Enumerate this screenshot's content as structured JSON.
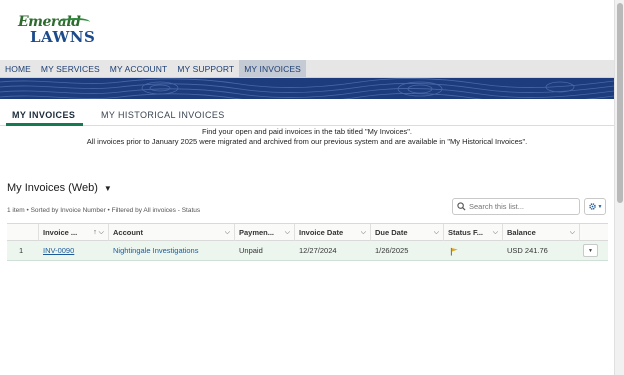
{
  "brand": {
    "script": "Emerald",
    "word": "LAWNS",
    "colors": {
      "green": "#2e6b2f",
      "blue": "#1d4a8a"
    }
  },
  "nav": {
    "items": [
      {
        "label": "HOME"
      },
      {
        "label": "MY SERVICES"
      },
      {
        "label": "MY ACCOUNT"
      },
      {
        "label": "MY SUPPORT"
      },
      {
        "label": "MY INVOICES",
        "active": true
      }
    ]
  },
  "banner": {
    "color": "#1d3c7d"
  },
  "tabs": {
    "active": "MY INVOICES",
    "historical": "MY HISTORICAL INVOICES",
    "accent": "#157a52"
  },
  "info": {
    "line1": "Find your open and paid invoices in the tab titled \"My Invoices\".",
    "line2": "All invoices prior to January 2025 were migrated and archived from our previous system and are available in \"My Historical Invoices\"."
  },
  "list": {
    "title": "My Invoices (Web)",
    "meta": "1 item • Sorted by Invoice Number • Filtered by All invoices - Status",
    "search_placeholder": "Search this list..."
  },
  "table": {
    "columns": [
      "Invoice ...",
      "Account",
      "Paymen...",
      "Invoice Date",
      "Due Date",
      "Status F...",
      "Balance"
    ],
    "rows": [
      {
        "num": "1",
        "invoice": "INV-0090",
        "account": "Nightingale Investigations",
        "payment": "Unpaid",
        "invoice_date": "12/27/2024",
        "due_date": "1/26/2025",
        "status_flag": "flag-icon",
        "balance": "USD 241.76"
      }
    ]
  }
}
